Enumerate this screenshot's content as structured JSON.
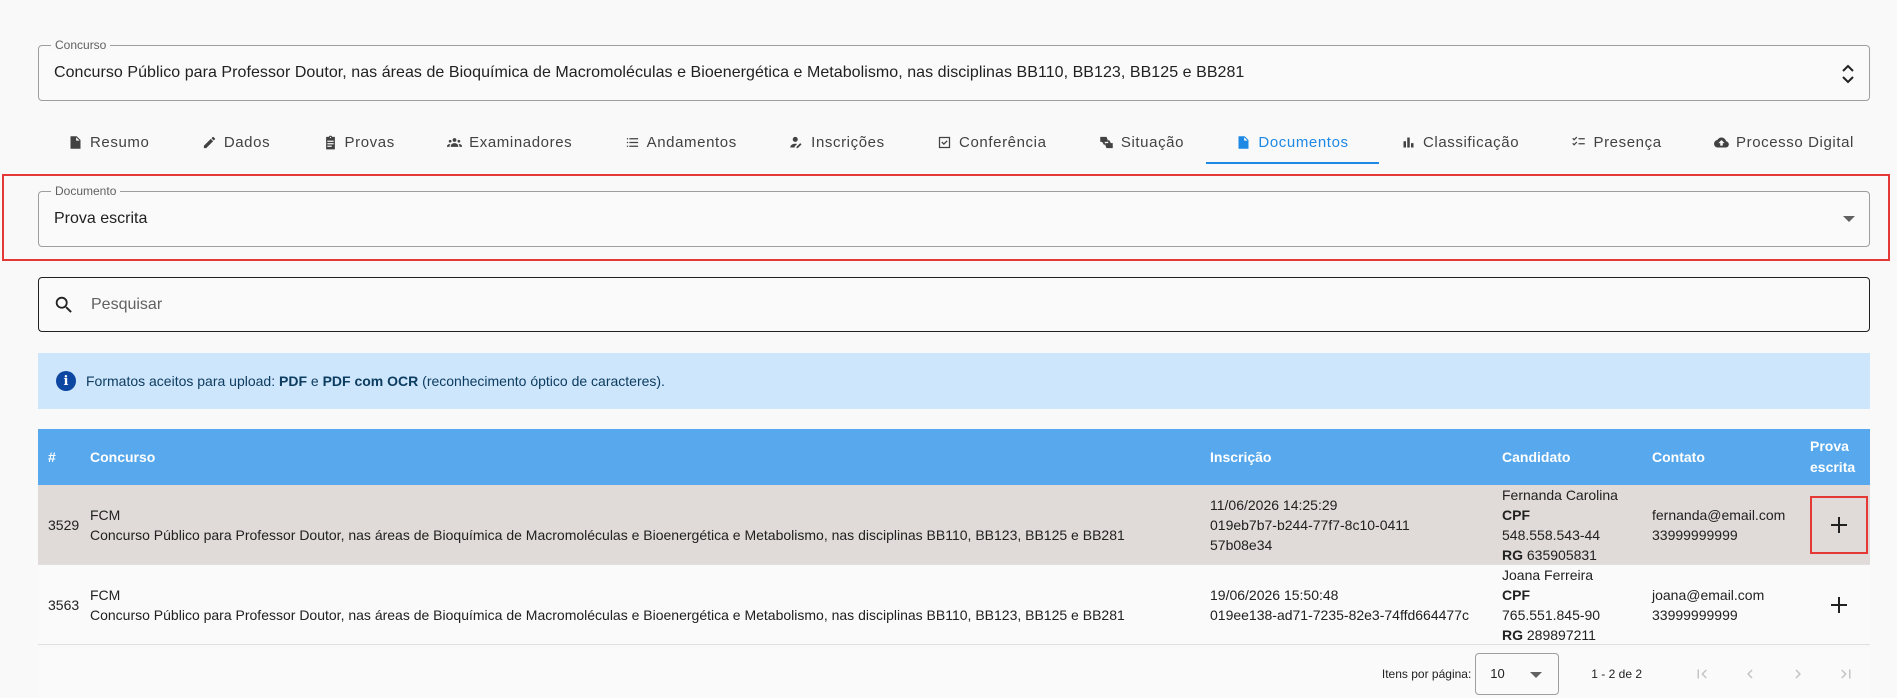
{
  "concurso_field": {
    "label": "Concurso",
    "value": "Concurso Público para Professor Doutor, nas áreas de Bioquímica de Macromoléculas e Bioenergética e Metabolismo, nas disciplinas BB110, BB123, BB125 e BB281"
  },
  "tabs": [
    {
      "label": "Resumo",
      "icon": "document-icon"
    },
    {
      "label": "Dados",
      "icon": "pencil-icon"
    },
    {
      "label": "Provas",
      "icon": "clipboard-icon"
    },
    {
      "label": "Examinadores",
      "icon": "group-icon"
    },
    {
      "label": "Andamentos",
      "icon": "list-icon"
    },
    {
      "label": "Inscrições",
      "icon": "person-edit-icon"
    },
    {
      "label": "Conferência",
      "icon": "checkbox-icon"
    },
    {
      "label": "Situação",
      "icon": "thumbs-icon"
    },
    {
      "label": "Documentos",
      "icon": "document-icon",
      "active": true
    },
    {
      "label": "Classificação",
      "icon": "bar-chart-icon"
    },
    {
      "label": "Presença",
      "icon": "checklist-icon"
    },
    {
      "label": "Processo Digital",
      "icon": "cloud-upload-icon"
    }
  ],
  "documento_field": {
    "label": "Documento",
    "value": "Prova escrita"
  },
  "search": {
    "placeholder": "Pesquisar"
  },
  "info_banner": {
    "prefix": "Formatos aceitos para upload: ",
    "fmt1": "PDF",
    "mid": " e ",
    "fmt2": "PDF com OCR",
    "suffix": " (reconhecimento óptico de caracteres)."
  },
  "table": {
    "headers": {
      "id": "#",
      "concurso": "Concurso",
      "inscricao": "Inscrição",
      "candidato": "Candidato",
      "contato": "Contato",
      "prova": "Prova escrita"
    },
    "cpf_label": "CPF",
    "rg_label": "RG",
    "rows": [
      {
        "id": "3529",
        "unit": "FCM",
        "concurso": "Concurso Público para Professor Doutor, nas áreas de Bioquímica de Macromoléculas e Bioenergética e Metabolismo, nas disciplinas BB110, BB123, BB125 e BB281",
        "date": "11/06/2026 14:25:29",
        "uuid": "019eb7b7-b244-77f7-8c10-041157b08e34",
        "name": "Fernanda Carolina",
        "cpf": "548.558.543-44",
        "rg": "635905831",
        "email": "fernanda@email.com",
        "phone": "33999999999"
      },
      {
        "id": "3563",
        "unit": "FCM",
        "concurso": "Concurso Público para Professor Doutor, nas áreas de Bioquímica de Macromoléculas e Bioenergética e Metabolismo, nas disciplinas BB110, BB123, BB125 e BB281",
        "date": "19/06/2026 15:50:48",
        "uuid": "019ee138-ad71-7235-82e3-74ffd664477c",
        "name": "Joana Ferreira",
        "cpf": "765.551.845-90",
        "rg": "289897211",
        "email": "joana@email.com",
        "phone": "33999999999"
      }
    ]
  },
  "pagination": {
    "per_page_label": "Itens por página:",
    "per_page_value": "10",
    "range": "1 - 2 de 2"
  },
  "colors": {
    "accent": "#1e88e5",
    "header_bg": "#57a8ed",
    "info_bg": "#cde6fb",
    "highlight": "#e53935"
  }
}
